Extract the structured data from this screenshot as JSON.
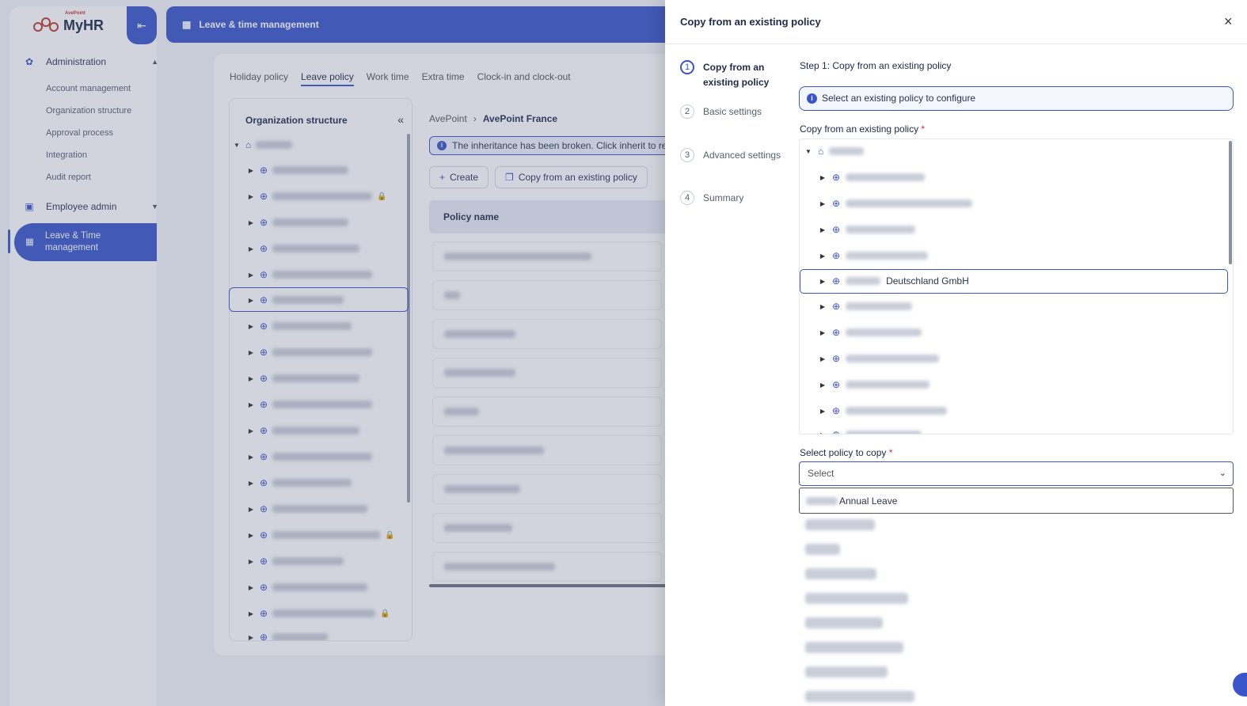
{
  "app": {
    "logo_brand": "AvePoint",
    "logo_text": "MyHR",
    "topbar_title": "Leave & time management"
  },
  "sidebar": {
    "groups": [
      {
        "label": "Administration",
        "items": [
          "Account management",
          "Organization structure",
          "Approval process",
          "Integration",
          "Audit report"
        ]
      },
      {
        "label": "Employee admin",
        "items": []
      }
    ],
    "active_item": "Leave & Time management"
  },
  "main": {
    "tabs": [
      "Holiday policy",
      "Leave policy",
      "Work time",
      "Extra time",
      "Clock-in and clock-out"
    ],
    "active_tab": "Leave policy",
    "org_title": "Organization structure",
    "breadcrumb": [
      "AvePoint",
      "AvePoint France"
    ],
    "info_text": "The inheritance has been broken. Click inherit to re-inhe",
    "buttons": [
      "Create",
      "Copy from an existing policy"
    ],
    "table_header": "Policy name"
  },
  "drawer": {
    "title": "Copy from an existing policy",
    "steps": [
      {
        "num": "1",
        "label": "Copy from an existing policy"
      },
      {
        "num": "2",
        "label": "Basic settings"
      },
      {
        "num": "3",
        "label": "Advanced settings"
      },
      {
        "num": "4",
        "label": "Summary"
      }
    ],
    "step_heading": "Step 1: Copy from an existing policy",
    "hint": "Select an existing policy to configure",
    "tree_label": "Copy from an existing policy",
    "selected_node": "Deutschland GmbH",
    "policy_label": "Select policy to copy",
    "select_placeholder": "Select",
    "highlighted_option": "Annual Leave",
    "required_mark": "*"
  }
}
